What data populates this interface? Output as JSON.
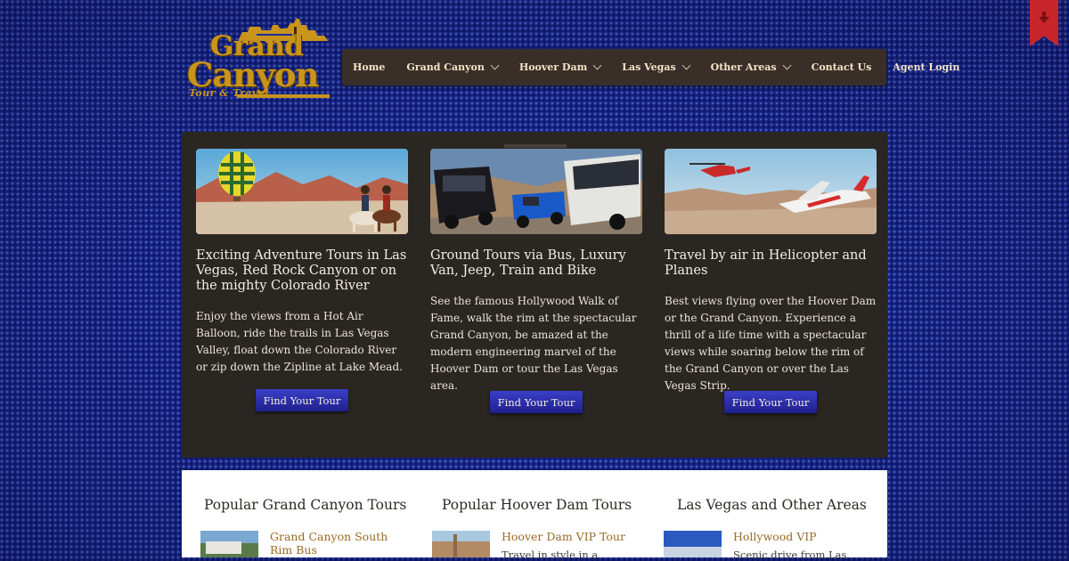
{
  "logo": {
    "line1": "Grand",
    "line2": "Canyon",
    "tagline": "Tour & Travel",
    "color": "#c8941c"
  },
  "nav": {
    "items": [
      {
        "label": "Home",
        "dropdown": false
      },
      {
        "label": "Grand Canyon",
        "dropdown": true
      },
      {
        "label": "Hoover Dam",
        "dropdown": true
      },
      {
        "label": "Las Vegas",
        "dropdown": true
      },
      {
        "label": "Other Areas",
        "dropdown": true
      },
      {
        "label": "Contact Us",
        "dropdown": false
      },
      {
        "label": "Agent Login",
        "dropdown": false
      }
    ]
  },
  "bookmark": {
    "icon": "download-arrow-icon",
    "color": "#c8252a"
  },
  "featured": {
    "cards": [
      {
        "image": "hot-air-balloon-horseback-riders",
        "title": "Exciting Adventure Tours in Las Vegas, Red Rock Canyon or on the mighty Colorado River",
        "text": "Enjoy the views from a Hot Air Balloon, ride the trails in Las Vegas Valley, float down the Colorado River or zip down the Zipline at Lake Mead.",
        "button": "Find Your Tour"
      },
      {
        "image": "bus-van-jeep",
        "title": "Ground Tours via Bus, Luxury Van, Jeep, Train and Bike",
        "text": "See the famous Hollywood Walk of Fame, walk the rim at the spectacular Grand Canyon, be amazed at the modern engineering marvel of the Hoover Dam or tour the Las Vegas area.",
        "button": "Find Your Tour"
      },
      {
        "image": "helicopter-plane",
        "title": "Travel by air in Helicopter and Planes",
        "text": "Best views flying over the Hoover Dam or the Grand Canyon. Experience a thrill of a life time with a spectacular views while soaring below the rim of the Grand Canyon or over the Las Vegas Strip.",
        "button": "Find Your Tour"
      }
    ]
  },
  "popular": {
    "columns": [
      {
        "title": "Popular Grand Canyon Tours",
        "item_title": "Grand Canyon South Rim Bus",
        "item_desc": ""
      },
      {
        "title": "Popular Hoover Dam Tours",
        "item_title": "Hoover Dam VIP Tour",
        "item_desc": "Travel in style in a"
      },
      {
        "title": "Las Vegas and Other Areas",
        "item_title": "Hollywood VIP",
        "item_desc": "Scenic drive from Las"
      }
    ]
  },
  "colors": {
    "button": "#2a2fb0",
    "panel": "#2a2622",
    "nav": "#3a2f28",
    "link": "#9a6a24"
  }
}
